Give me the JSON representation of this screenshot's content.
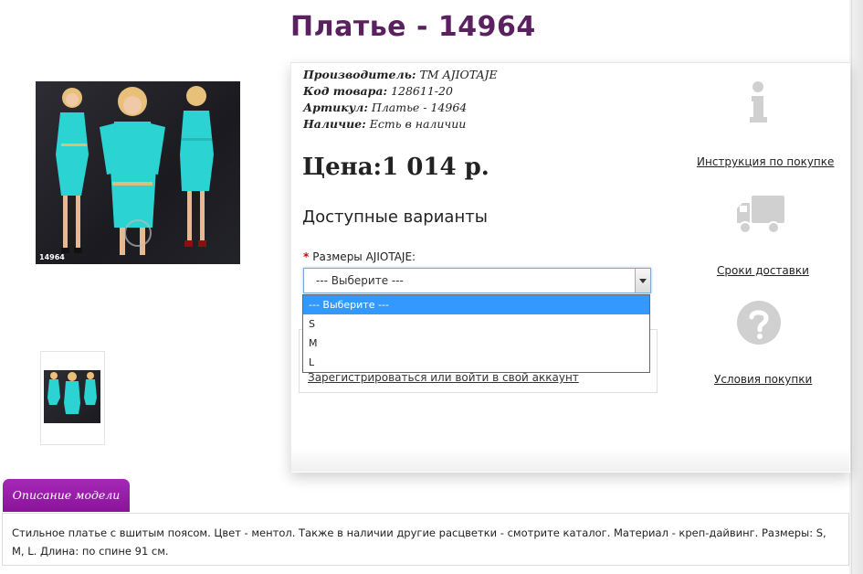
{
  "product": {
    "title": "Платье - 14964",
    "image_code": "14964",
    "meta": [
      {
        "label": "Производитель:",
        "value": "ТМ AJIOTAJE"
      },
      {
        "label": "Код товара:",
        "value": "128611-20"
      },
      {
        "label": "Артикул:",
        "value": "Платье - 14964"
      },
      {
        "label": "Наличие:",
        "value": "Есть в наличии"
      }
    ],
    "price": "Цена:1 014 р.",
    "variants_heading": "Доступные варианты",
    "size_label": "Размеры AJIOTAJE:",
    "required_mark": "*",
    "size_select_value": "--- Выберите ---",
    "size_options": [
      "--- Выберите ---",
      "S",
      "M",
      "L"
    ],
    "login_link": "Зарегистрироваться или войти в свой аккаунт"
  },
  "sidebar": {
    "instruction_link": "Инструкция по покупке",
    "delivery_link": "Сроки доставки",
    "terms_link": "Условия покупки"
  },
  "description": {
    "tab_label": "Описание модели",
    "text": "Стильное платье с вшитым поясом. Цвет - ментол. Также в наличии другие расцветки - смотрите каталог. Материал - креп-дайвинг. Размеры: S, M, L. Длина: по спине 91 см."
  },
  "colors": {
    "title": "#5a2060",
    "tab": "#9b1fad",
    "dress": "#2bd3d3",
    "select_highlight": "#3399ff"
  }
}
